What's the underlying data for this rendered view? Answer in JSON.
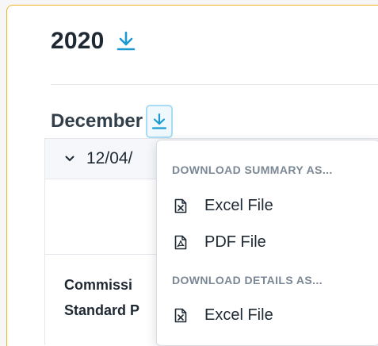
{
  "year": {
    "title": "2020",
    "download_icon": "download-icon"
  },
  "month": {
    "title": "December",
    "download_icon": "download-icon"
  },
  "table": {
    "group_date": "12/04/",
    "chevron_icon": "chevron-down-icon",
    "info_lines": [
      "Commissi",
      "Standard P"
    ]
  },
  "dropdown": {
    "sections": [
      {
        "title": "DOWNLOAD SUMMARY AS...",
        "items": [
          {
            "label": "Excel File",
            "icon": "excel-file-icon"
          },
          {
            "label": "PDF File",
            "icon": "pdf-file-icon"
          }
        ]
      },
      {
        "title": "DOWNLOAD DETAILS AS...",
        "items": [
          {
            "label": "Excel File",
            "icon": "excel-file-icon"
          }
        ]
      }
    ]
  },
  "colors": {
    "accent": "#1b9ad1",
    "focus_ring": "#a9dcf2",
    "panel_border": "#f0b429",
    "text_dark": "#1f2933",
    "section_gray": "#7b8794"
  }
}
